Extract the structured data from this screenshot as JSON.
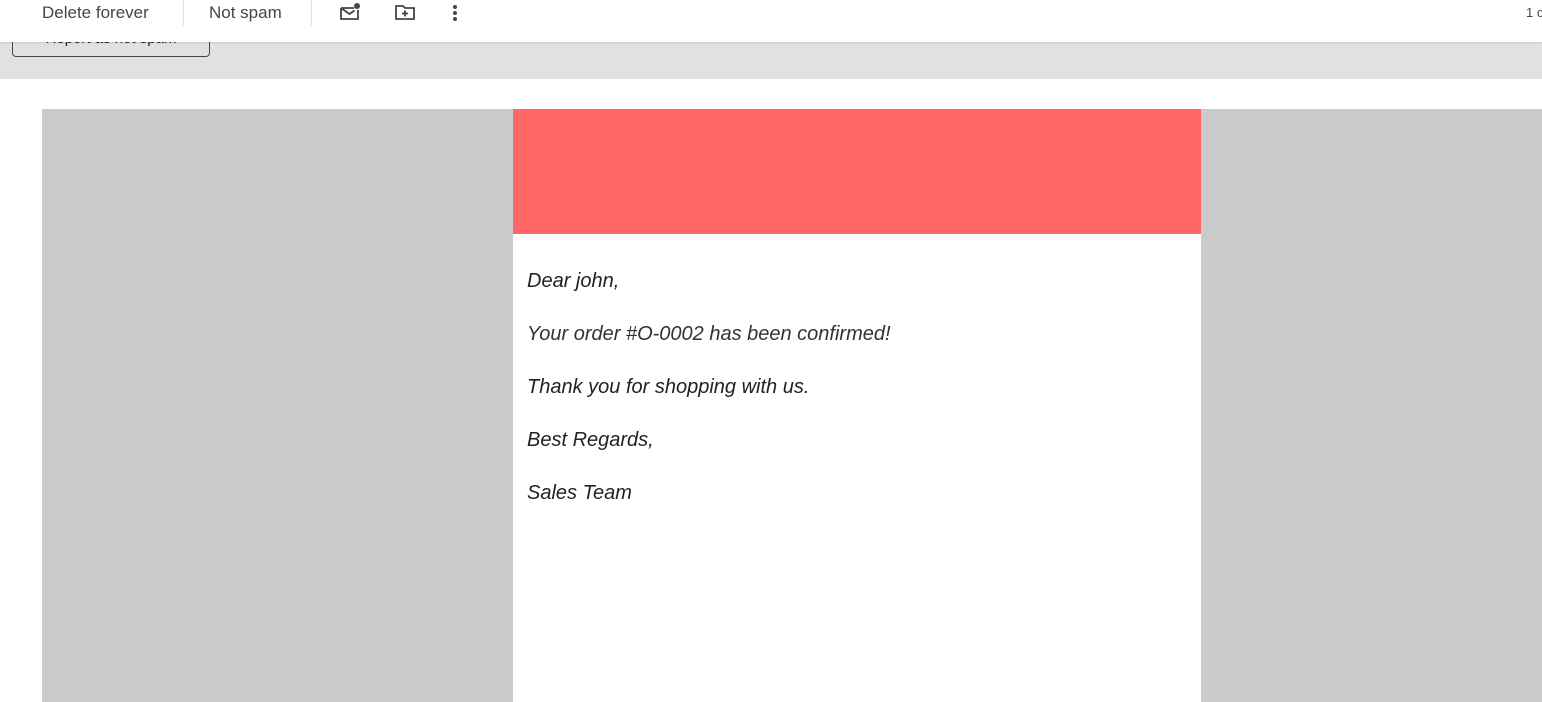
{
  "toolbar": {
    "delete_forever": "Delete forever",
    "not_spam": "Not spam",
    "icons": [
      "mark-unread-icon",
      "move-to-icon",
      "more-options-icon"
    ],
    "count_text": "1 c"
  },
  "banner": {
    "button_label": "Report as not spam"
  },
  "email": {
    "header_color": "#ff6666",
    "greeting": "Dear john,",
    "confirmation": "Your order #O-0002 has been confirmed!",
    "thanks": "Thank you for shopping with us.",
    "regards": "Best Regards,",
    "signature": "Sales Team"
  }
}
